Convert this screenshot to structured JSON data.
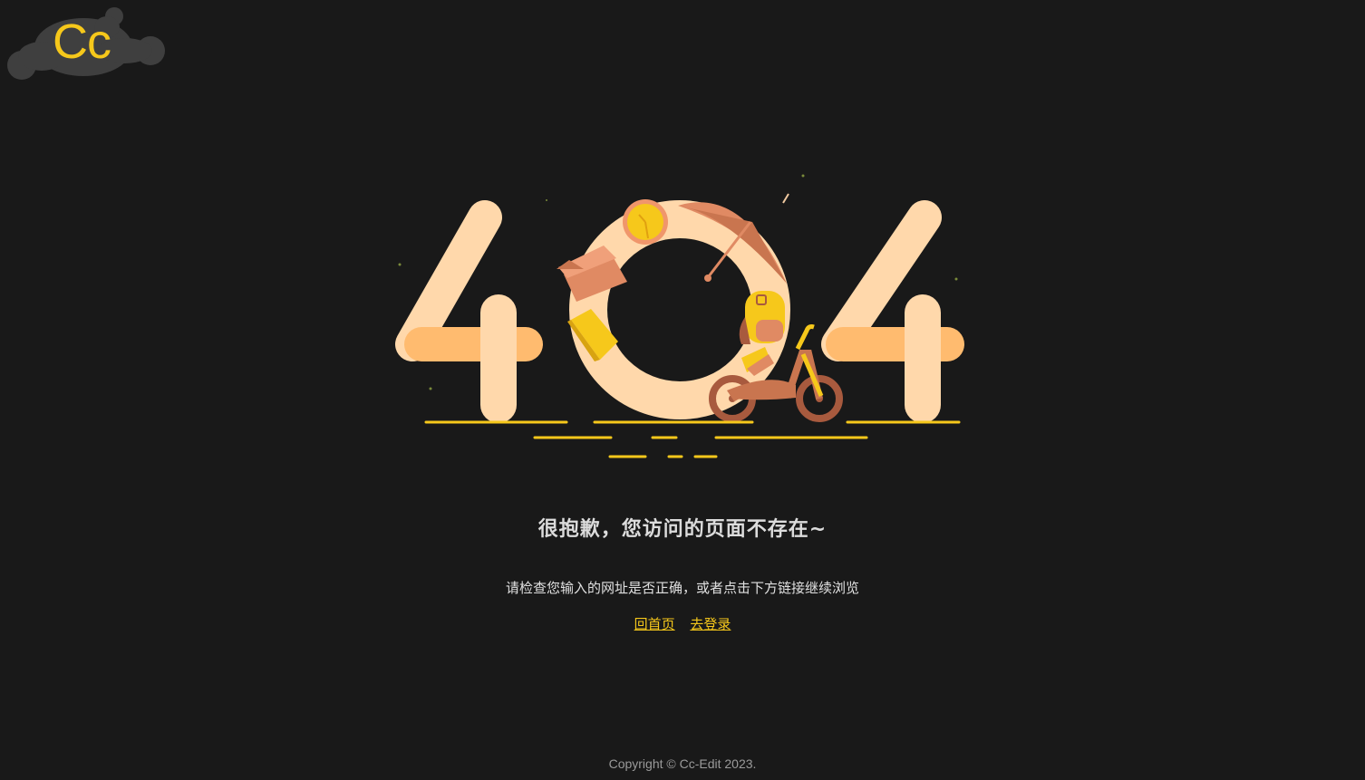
{
  "logo": {
    "text": "Cc",
    "colors": {
      "blob": "#3f3f3f",
      "text": "#f6c81b"
    }
  },
  "illustration": {
    "icon": "404-illustration",
    "digits": "404",
    "colors": {
      "digit": "#ffd8ab",
      "digit_shadow": "#ffbb6f",
      "accent_yellow": "#f6c81b",
      "accent_orange": "#e08a63",
      "accent_brown": "#a85a3e"
    }
  },
  "message": {
    "title": "很抱歉，您访问的页面不存在~",
    "subtitle": "请检查您输入的网址是否正确，或者点击下方链接继续浏览"
  },
  "links": {
    "home": "回首页",
    "login": "去登录"
  },
  "footer": {
    "copyright": "Copyright © Cc-Edit 2023."
  }
}
